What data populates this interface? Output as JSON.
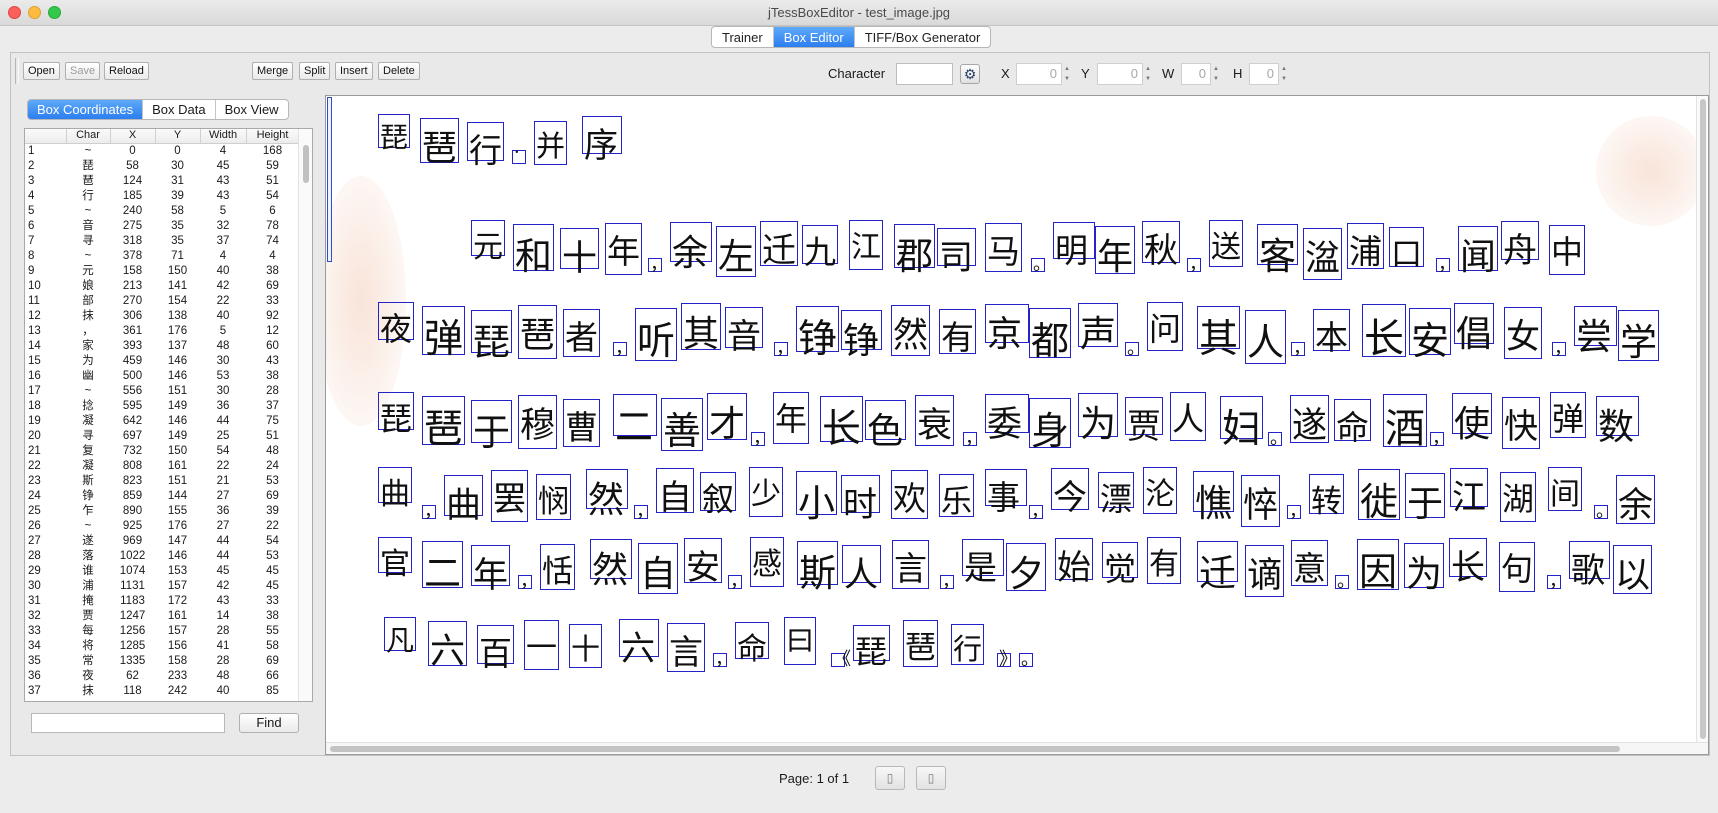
{
  "window": {
    "title": "jTessBoxEditor - test_image.jpg"
  },
  "tabs": [
    {
      "label": "Trainer",
      "active": false
    },
    {
      "label": "Box Editor",
      "active": true
    },
    {
      "label": "TIFF/Box Generator",
      "active": false
    }
  ],
  "toolbar": {
    "open_label": "Open",
    "save_label": "Save",
    "reload_label": "Reload",
    "merge_label": "Merge",
    "split_label": "Split",
    "insert_label": "Insert",
    "delete_label": "Delete",
    "character_label": "Character",
    "character_value": "",
    "settings_icon": "gear-icon",
    "x_label": "X",
    "x_value": "0",
    "y_label": "Y",
    "y_value": "0",
    "w_label": "W",
    "w_value": "0",
    "h_label": "H",
    "h_value": "0"
  },
  "left_tabs": [
    {
      "label": "Box Coordinates",
      "active": true
    },
    {
      "label": "Box Data",
      "active": false
    },
    {
      "label": "Box View",
      "active": false
    }
  ],
  "table": {
    "columns": [
      "",
      "Char",
      "X",
      "Y",
      "Width",
      "Height"
    ],
    "rows": [
      [
        "1",
        "~",
        "0",
        "0",
        "4",
        "168"
      ],
      [
        "2",
        "琵",
        "58",
        "30",
        "45",
        "59"
      ],
      [
        "3",
        "琶",
        "124",
        "31",
        "43",
        "51"
      ],
      [
        "4",
        "行",
        "185",
        "39",
        "43",
        "54"
      ],
      [
        "5",
        "~",
        "240",
        "58",
        "5",
        "6"
      ],
      [
        "6",
        "音",
        "275",
        "35",
        "32",
        "78"
      ],
      [
        "7",
        "寻",
        "318",
        "35",
        "37",
        "74"
      ],
      [
        "8",
        "~",
        "378",
        "71",
        "4",
        "4"
      ],
      [
        "9",
        "元",
        "158",
        "150",
        "40",
        "38"
      ],
      [
        "10",
        "娘",
        "213",
        "141",
        "42",
        "69"
      ],
      [
        "11",
        "部",
        "270",
        "154",
        "22",
        "33"
      ],
      [
        "12",
        "抹",
        "306",
        "138",
        "40",
        "92"
      ],
      [
        "13",
        "，",
        "361",
        "176",
        "5",
        "12"
      ],
      [
        "14",
        "家",
        "393",
        "137",
        "48",
        "60"
      ],
      [
        "15",
        "为",
        "459",
        "146",
        "30",
        "43"
      ],
      [
        "16",
        "幽",
        "500",
        "146",
        "53",
        "38"
      ],
      [
        "17",
        "~",
        "556",
        "151",
        "30",
        "28"
      ],
      [
        "18",
        "捻",
        "595",
        "149",
        "36",
        "37"
      ],
      [
        "19",
        "凝",
        "642",
        "146",
        "44",
        "75"
      ],
      [
        "20",
        "寻",
        "697",
        "149",
        "25",
        "51"
      ],
      [
        "21",
        "复",
        "732",
        "150",
        "54",
        "48"
      ],
      [
        "22",
        "凝",
        "808",
        "161",
        "22",
        "24"
      ],
      [
        "23",
        "斯",
        "823",
        "151",
        "21",
        "53"
      ],
      [
        "24",
        "铮",
        "859",
        "144",
        "27",
        "69"
      ],
      [
        "25",
        "乍",
        "890",
        "155",
        "36",
        "39"
      ],
      [
        "26",
        "~",
        "925",
        "176",
        "27",
        "22"
      ],
      [
        "27",
        "遂",
        "969",
        "147",
        "44",
        "54"
      ],
      [
        "28",
        "落",
        "1022",
        "146",
        "44",
        "53"
      ],
      [
        "29",
        "谁",
        "1074",
        "153",
        "45",
        "45"
      ],
      [
        "30",
        "浦",
        "1131",
        "157",
        "42",
        "45"
      ],
      [
        "31",
        "掩",
        "1183",
        "172",
        "43",
        "33"
      ],
      [
        "32",
        "贾",
        "1247",
        "161",
        "14",
        "38"
      ],
      [
        "33",
        "每",
        "1256",
        "157",
        "28",
        "55"
      ],
      [
        "34",
        "将",
        "1285",
        "156",
        "41",
        "58"
      ],
      [
        "35",
        "常",
        "1335",
        "158",
        "28",
        "69"
      ],
      [
        "36",
        "夜",
        "62",
        "233",
        "48",
        "66"
      ],
      [
        "37",
        "抹",
        "118",
        "242",
        "40",
        "85"
      ]
    ]
  },
  "find": {
    "value": "",
    "button_label": "Find"
  },
  "pagination": {
    "label": "Page: 1 of 1",
    "prev_icon": "page-back-icon",
    "next_icon": "page-forward-icon"
  },
  "image": {
    "description_lines": [
      "琵琶行·并序",
      "元和十年，余左迁九江郡司马。明年秋，送客湓浦口，闻舟中",
      "夜弹琵琶者，听其音，铮铮然有京都声。问其人，本长安倡女，尝学",
      "琵琶于穆曹二善才，年长色衰，委身为贾人妇。遂命酒，使快弹数",
      "曲，曲罢悯然，自叙少小时欢乐事，今漂沦憔悴，转徙于江湖间。余出",
      "官二年，恬然自安，感斯人言，是夕始觉有迁谪意。因为长句，歌以赠之，",
      "凡六百一十六言，命曰《琵琶行》。"
    ]
  },
  "colors": {
    "accent": "#2c7ef0",
    "box_border": "#2323c9"
  }
}
